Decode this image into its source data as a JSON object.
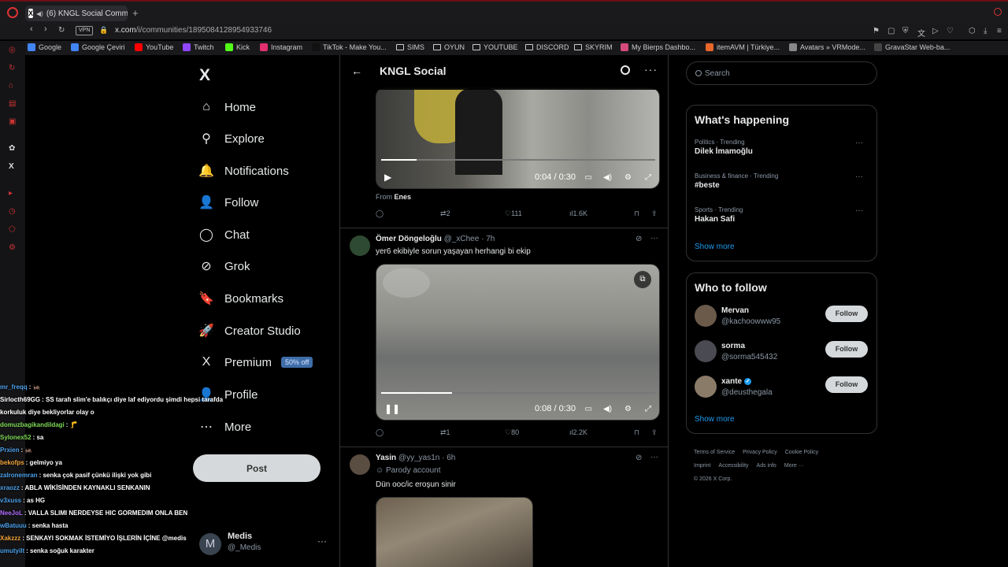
{
  "browser": {
    "tab_title": "(6) KNGL Social Comm",
    "url_host": "x.com",
    "url_path": "/i/communities/1895084128954933746",
    "vpn_label": "VPN",
    "bookmarks": [
      {
        "label": "Google",
        "icon": "google-icon",
        "color": "#4285f4"
      },
      {
        "label": "Google Çeviri",
        "icon": "translate-icon",
        "color": "#4285f4"
      },
      {
        "label": "YouTube",
        "icon": "youtube-icon",
        "color": "#ff0000"
      },
      {
        "label": "Twitch",
        "icon": "twitch-icon",
        "color": "#9146ff"
      },
      {
        "label": "Kick",
        "icon": "kick-icon",
        "color": "#53fc18"
      },
      {
        "label": "Instagram",
        "icon": "instagram-icon",
        "color": "#e1306c"
      },
      {
        "label": "TikTok - Make You...",
        "icon": "tiktok-icon",
        "color": "#111111"
      },
      {
        "label": "SIMS",
        "icon": "folder-icon"
      },
      {
        "label": "OYUN",
        "icon": "folder-icon"
      },
      {
        "label": "YOUTUBE",
        "icon": "folder-icon"
      },
      {
        "label": "DISCORD",
        "icon": "folder-icon"
      },
      {
        "label": "SKYRIM",
        "icon": "folder-icon"
      },
      {
        "label": "My Bierps Dashbo...",
        "icon": "bierps-icon",
        "color": "#d64a7a"
      },
      {
        "label": "itemAVM | Türkiye...",
        "icon": "itemavm-icon",
        "color": "#e8662a"
      },
      {
        "label": "Avatars » VRMode...",
        "icon": "vrmodels-icon",
        "color": "#888888"
      },
      {
        "label": "GravaStar Web-ba...",
        "icon": "gravastar-icon",
        "color": "#444444"
      }
    ]
  },
  "nav": {
    "logo": "X",
    "items": [
      {
        "label": "Home",
        "icon": "home-icon",
        "glyph": "⌂"
      },
      {
        "label": "Explore",
        "icon": "search-icon",
        "glyph": "⚲"
      },
      {
        "label": "Notifications",
        "icon": "bell-icon",
        "glyph": "🔔"
      },
      {
        "label": "Follow",
        "icon": "person-add-icon",
        "glyph": "👤"
      },
      {
        "label": "Chat",
        "icon": "chat-icon",
        "glyph": "◯"
      },
      {
        "label": "Grok",
        "icon": "grok-icon",
        "glyph": "⊘"
      },
      {
        "label": "Bookmarks",
        "icon": "bookmark-icon",
        "glyph": "🔖"
      },
      {
        "label": "Creator Studio",
        "icon": "rocket-icon",
        "glyph": "🚀"
      },
      {
        "label": "Premium",
        "icon": "x-premium-icon",
        "glyph": "X"
      },
      {
        "label": "Profile",
        "icon": "profile-icon",
        "glyph": "👤"
      },
      {
        "label": "More",
        "icon": "more-circle-icon",
        "glyph": "⋯"
      }
    ],
    "premium_badge": "50% off",
    "post_label": "Post",
    "account": {
      "initial": "M",
      "name": "Medis",
      "handle": "@_Medis"
    }
  },
  "chat": [
    {
      "user": "mr_freqq",
      "color": "#4a9fe8",
      "msg": ": 🦗"
    },
    {
      "user": "Sirlocth69GG",
      "color": "#ffffff",
      "msg": ": SS tarafı slim'e balıkçı diye laf ediyordu şimdi hepsi tarafda"
    },
    {
      "user": "",
      "color": "#ffffff",
      "msg": "korkuluk diye bekliyorlar olay o"
    },
    {
      "user": "domuzbagikandildagi",
      "color": "#7ed957",
      "msg": ": 🦵"
    },
    {
      "user": "Sylonex52",
      "color": "#7ed957",
      "msg": ": sa"
    },
    {
      "user": "Prxien",
      "color": "#4a9fe8",
      "msg": ": 🦗"
    },
    {
      "user": "bekofps",
      "color": "#f2a33a",
      "msg": ": gelmiyo ya"
    },
    {
      "user": "zalronemran",
      "color": "#4a9fe8",
      "msg": ": senka çok pasif çünkü ilişki yok gibi"
    },
    {
      "user": "xraozz",
      "color": "#4a9fe8",
      "msg": ": ABLA WİKİSİNDEN KAYNAKLI SENKANIN"
    },
    {
      "user": "v3xuss",
      "color": "#4a9fe8",
      "msg": ": as HG"
    },
    {
      "user": "NeeJoL",
      "color": "#b06cff",
      "msg": ": VALLA SLIMI NERDEYSE HIC GORMEDIM ONLA BEN"
    },
    {
      "user": "wBatuuu",
      "color": "#4a9fe8",
      "msg": ": senka hasta"
    },
    {
      "user": "Xakzzz",
      "color": "#f2a33a",
      "msg": ": SENKAYI SOKMAK İSTEMİYO İŞLERİN İÇİNE @medis"
    },
    {
      "user": "umutyilt",
      "color": "#4a9fe8",
      "msg": ": senka soğuk karakter"
    }
  ],
  "feed": {
    "title": "KNGL Social",
    "tweet1": {
      "video_time": "0:04 / 0:30",
      "progress": 0.13,
      "from_prefix": "From",
      "from_name": "Enes",
      "retweets": "2",
      "likes": "111",
      "views": "1.6K"
    },
    "tweet2": {
      "name": "Ömer Döngeloğlu",
      "handle": "@_xChee",
      "time": "7h",
      "text": "yer6 ekibiyle sorun yaşayan herhangi bi ekip",
      "video_time": "0:08 / 0:30",
      "progress": 0.26,
      "retweets": "1",
      "likes": "80",
      "views": "2.2K"
    },
    "tweet3": {
      "name": "Yasin",
      "handle": "@yy_yas1n",
      "time": "6h",
      "parody": "Parody account",
      "text": "Dün ooc/ic eroşun sinir"
    }
  },
  "right": {
    "search_placeholder": "Search",
    "happening_title": "What's happening",
    "trends": [
      {
        "context": "Politics · Trending",
        "title": "Dilek İmamoğlu"
      },
      {
        "context": "Business & finance · Trending",
        "title": "#beste"
      },
      {
        "context": "Sports · Trending",
        "title": "Hakan Safi"
      }
    ],
    "show_more": "Show more",
    "who_title": "Who to follow",
    "who": [
      {
        "name": "Mervan",
        "handle": "@kachoowww95",
        "verified": false,
        "color": "#6b5a4a"
      },
      {
        "name": "sorma",
        "handle": "@sorma545432",
        "verified": false,
        "color": "#4a4a52"
      },
      {
        "name": "xante",
        "handle": "@deusthegala",
        "verified": true,
        "color": "#8a7a68"
      }
    ],
    "follow_label": "Follow",
    "footer": [
      "Terms of Service",
      "Privacy Policy",
      "Cookie Policy",
      "Imprint",
      "Accessibility",
      "Ads info",
      "More ···",
      "© 2026 X Corp."
    ]
  }
}
